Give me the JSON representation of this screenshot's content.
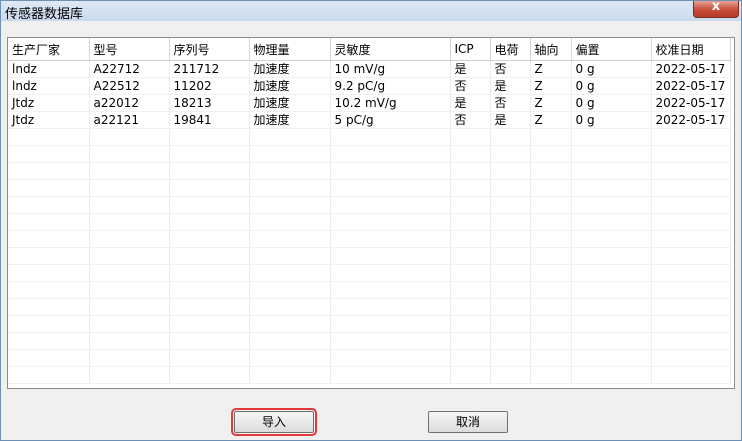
{
  "window": {
    "title": "传感器数据库",
    "close_label": "x"
  },
  "table": {
    "columns": [
      "生产厂家",
      "型号",
      "序列号",
      "物理量",
      "灵敏度",
      "ICP",
      "电荷",
      "轴向",
      "偏置",
      "校准日期"
    ],
    "rows": [
      [
        "lndz",
        "A22712",
        "211712",
        "加速度",
        "10 mV/g",
        "是",
        "否",
        "Z",
        "0 g",
        "2022-05-17"
      ],
      [
        "lndz",
        "A22512",
        "11202",
        "加速度",
        "9.2 pC/g",
        "否",
        "是",
        "Z",
        "0 g",
        "2022-05-17"
      ],
      [
        "Jtdz",
        "a22012",
        "18213",
        "加速度",
        "10.2 mV/g",
        "是",
        "否",
        "Z",
        "0 g",
        "2022-05-17"
      ],
      [
        "Jtdz",
        "a22121",
        "19841",
        "加速度",
        "5 pC/g",
        "否",
        "是",
        "Z",
        "0 g",
        "2022-05-17"
      ]
    ]
  },
  "buttons": {
    "import_label": "导入",
    "cancel_label": "取消"
  },
  "colors": {
    "highlight": "#e23a3a",
    "titlebar": "#c9d9ec"
  }
}
